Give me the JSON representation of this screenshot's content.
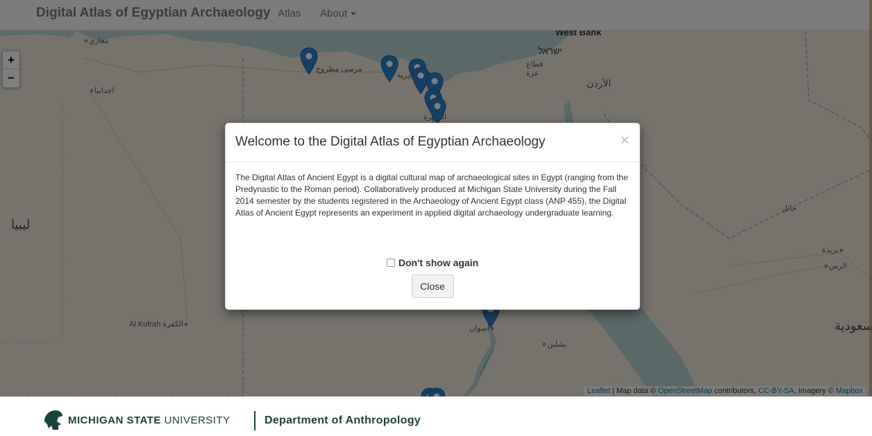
{
  "navbar": {
    "brand": "Digital Atlas of Egyptian Archaeology",
    "atlas_link": "Atlas",
    "about_link": "About"
  },
  "map": {
    "zoom_in": "+",
    "zoom_out": "−",
    "places": {
      "west_bank": "West Bank",
      "israel": "ישראל",
      "gaza": "قطاع غزة",
      "jordan": "الأردن",
      "benghazi": "بنغازي",
      "ajdabiya": "اجدابيا",
      "marsa_matruh": "مرسى مطروح",
      "alexandria": "الإسكندرية",
      "cairo": "القاهرة",
      "libya": "ليبيا",
      "hail": "حائل",
      "buraydah": "بريدة",
      "ar_rass": "الرس",
      "al_kufrah": "Al Kufrah الكفرة",
      "aswan": "أسوان",
      "bishlin": "بشلين",
      "saudi": "السعودية"
    },
    "attribution": {
      "leaflet": "Leaflet",
      "sep1": " | Map data © ",
      "osm": "OpenStreetMap",
      "contributors": " contributors, ",
      "license": "CC-BY-SA",
      "imagery": ", Imagery © ",
      "mapbox": "Mapbox"
    }
  },
  "modal": {
    "title": "Welcome to the Digital Atlas of Egyptian Archaeology",
    "close_x": "×",
    "body": "The Digital Atlas of Ancient Egypt is a digital cultural map of archaeological sites in Egypt (ranging from the Predynastic to the Roman period). Collaboratively produced at Michigan State University during the Fall 2014 semester by the students registered in the Archaeology of Ancient Egypt class (ANP 455), the Digital Atlas of Ancient Egypt represents an experiment in applied digital archaeology undergraduate learning.",
    "dont_show_label": "Don't show again",
    "dont_show_checked": false,
    "close_button": "Close"
  },
  "footer": {
    "msu_bold": "MICHIGAN STATE",
    "msu_light": " UNIVERSITY",
    "department": "Department of Anthropology"
  },
  "colors": {
    "marker": "#2a81cb",
    "msu_green": "#18453b",
    "sea": "#b5d0d0"
  }
}
